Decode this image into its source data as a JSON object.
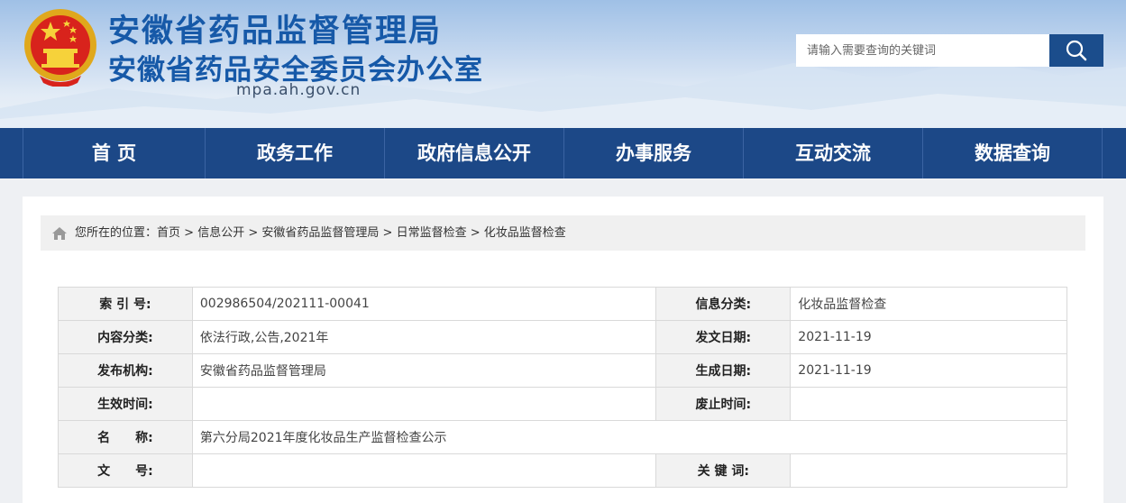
{
  "header": {
    "title_line1": "安徽省药品监督管理局",
    "title_line2": "安徽省药品安全委员会办公室",
    "domain": "mpa.ah.gov.cn",
    "search_placeholder": "请输入需要查询的关键词"
  },
  "nav": {
    "items": [
      "首 页",
      "政务工作",
      "政府信息公开",
      "办事服务",
      "互动交流",
      "数据查询"
    ]
  },
  "breadcrumb": {
    "prefix": "您所在的位置：",
    "items": [
      "首页",
      "信息公开",
      "安徽省药品监督管理局",
      "日常监督检查",
      "化妆品监督检查"
    ],
    "separator": " > "
  },
  "meta": {
    "index_label": "索 引 号:",
    "index_value": "002986504/202111-00041",
    "category_label": "信息分类:",
    "category_value": "化妆品监督检查",
    "content_label": "内容分类:",
    "content_value": "依法行政,公告,2021年",
    "issue_date_label": "发文日期:",
    "issue_date_value": "2021-11-19",
    "publisher_label": "发布机构:",
    "publisher_value": "安徽省药品监督管理局",
    "gen_date_label": "生成日期:",
    "gen_date_value": "2021-11-19",
    "effective_label": "生效时间:",
    "effective_value": "",
    "abolish_label": "废止时间:",
    "abolish_value": "",
    "name_label": "名　　称:",
    "name_value": "第六分局2021年度化妆品生产监督检查公示",
    "doc_no_label": "文　　号:",
    "doc_no_value": "",
    "keywords_label": "关 键 词:",
    "keywords_value": ""
  },
  "colors": {
    "brand_blue": "#1659a8",
    "nav_bg": "#1c4887",
    "search_btn": "#1b4d8c"
  },
  "icons": [
    "national-emblem",
    "search-icon",
    "home-icon"
  ]
}
